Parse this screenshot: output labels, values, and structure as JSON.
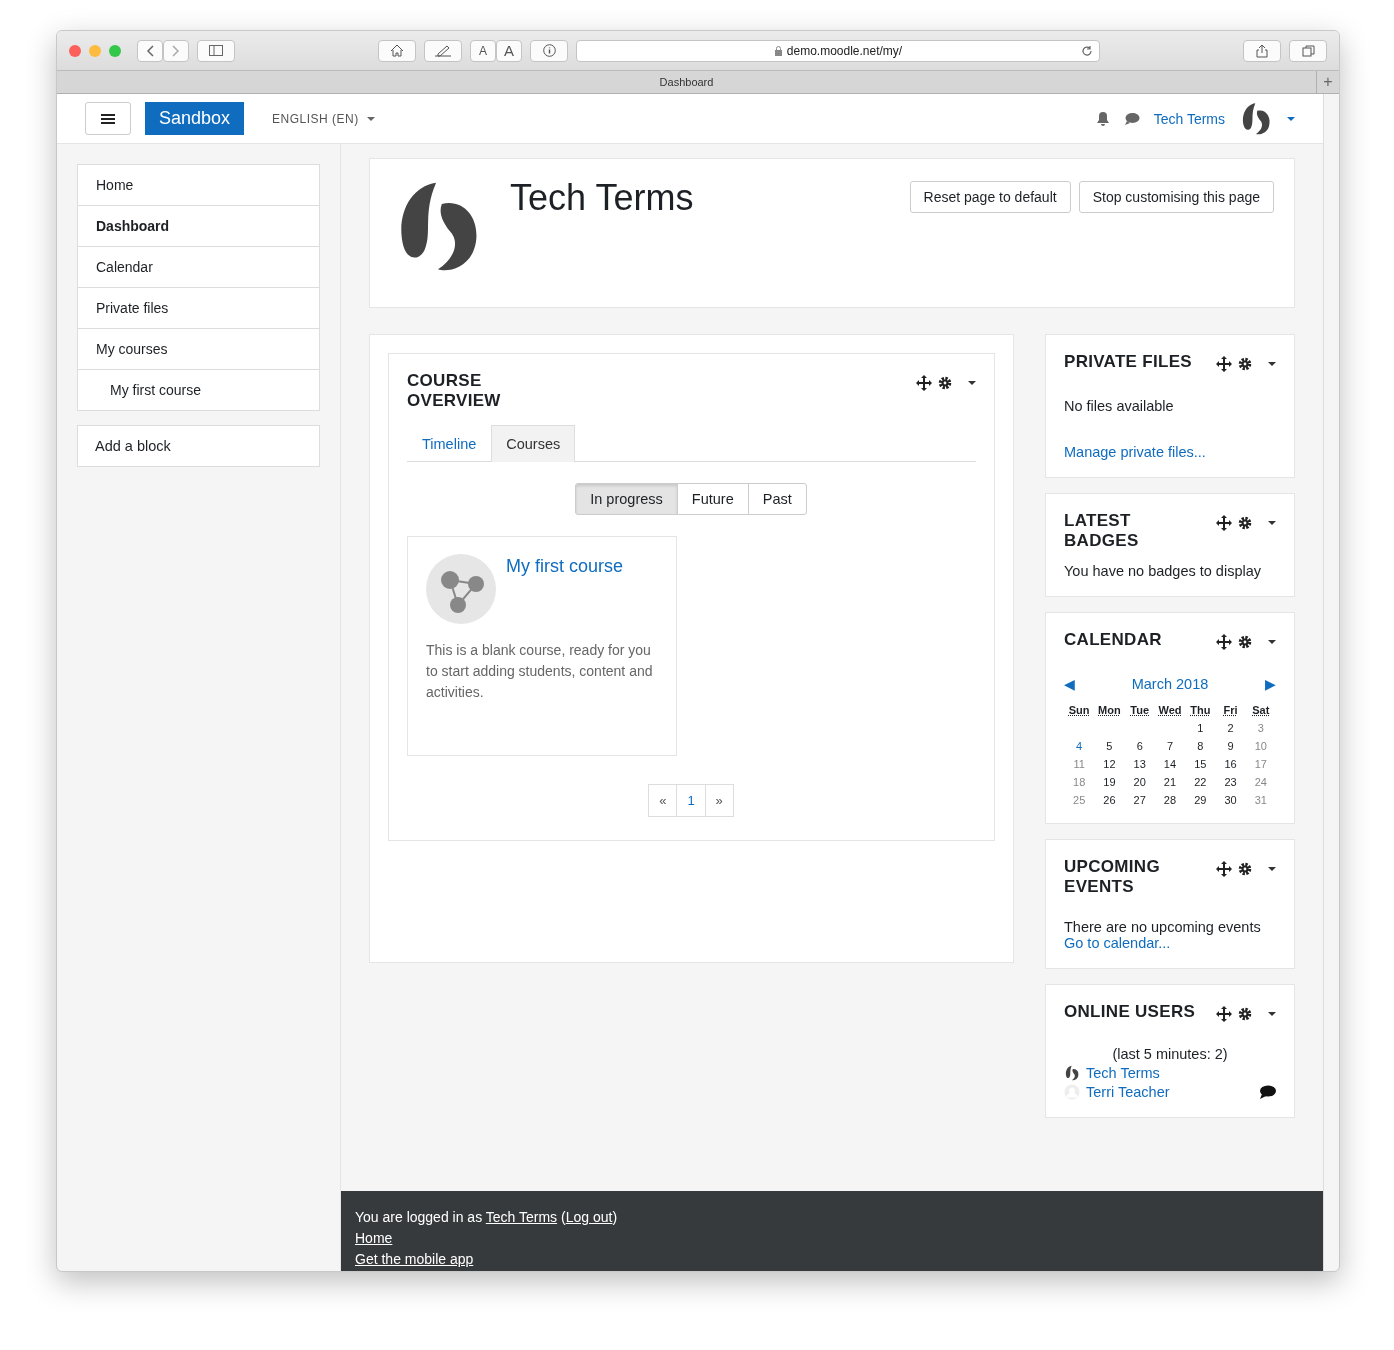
{
  "browser": {
    "url": "demo.moodle.net/my/",
    "font_buttons": [
      "A",
      "A"
    ],
    "tab_title": "Dashboard",
    "new_tab": "+"
  },
  "navbar": {
    "brand": "Sandbox",
    "language": "ENGLISH (EN)",
    "user": "Tech Terms"
  },
  "sidebar": {
    "items": [
      {
        "label": "Home",
        "selected": false
      },
      {
        "label": "Dashboard",
        "selected": true
      },
      {
        "label": "Calendar",
        "selected": false
      },
      {
        "label": "Private files",
        "selected": false
      },
      {
        "label": "My courses",
        "selected": false,
        "children": [
          {
            "label": "My first course",
            "selected": false
          }
        ]
      }
    ],
    "add_block": "Add a block"
  },
  "header": {
    "title": "Tech Terms",
    "buttons": [
      "Reset page to default",
      "Stop customising this page"
    ]
  },
  "course_overview": {
    "title": "COURSE OVERVIEW",
    "tabs": [
      {
        "label": "Timeline",
        "selected": false
      },
      {
        "label": "Courses",
        "selected": true
      }
    ],
    "filters": [
      {
        "label": "In progress",
        "selected": true
      },
      {
        "label": "Future",
        "selected": false
      },
      {
        "label": "Past",
        "selected": false
      }
    ],
    "courses": [
      {
        "name": "My first course",
        "summary": "This is a blank course, ready for you to start adding students, content and activities."
      }
    ],
    "pagination": [
      {
        "label": "«",
        "selected": false
      },
      {
        "label": "1",
        "selected": true
      },
      {
        "label": "»",
        "selected": false
      }
    ]
  },
  "blocks": [
    {
      "kind": "files",
      "title": "PRIVATE FILES",
      "text": "No files available",
      "link": "Manage private files..."
    },
    {
      "kind": "badges",
      "title": "LATEST BADGES",
      "text": "You have no badges to display"
    },
    {
      "kind": "calendar",
      "title": "CALENDAR",
      "month": "March 2018",
      "prev": "◀",
      "next": "▶",
      "weekdays": [
        "Sun",
        "Mon",
        "Tue",
        "Wed",
        "Thu",
        "Fri",
        "Sat"
      ],
      "weeks": [
        [
          {
            "day": "1",
            "kind": "weekday"
          },
          {
            "day": "2",
            "kind": "weekday"
          },
          {
            "day": "3",
            "kind": "weekend"
          }
        ],
        [
          {
            "day": "4",
            "kind": "today"
          },
          {
            "day": "5",
            "kind": "weekday"
          },
          {
            "day": "6",
            "kind": "weekday"
          },
          {
            "day": "7",
            "kind": "weekday"
          },
          {
            "day": "8",
            "kind": "weekday"
          },
          {
            "day": "9",
            "kind": "weekday"
          },
          {
            "day": "10",
            "kind": "weekend"
          }
        ],
        [
          {
            "day": "11",
            "kind": "weekend"
          },
          {
            "day": "12",
            "kind": "weekday"
          },
          {
            "day": "13",
            "kind": "weekday"
          },
          {
            "day": "14",
            "kind": "weekday"
          },
          {
            "day": "15",
            "kind": "weekday"
          },
          {
            "day": "16",
            "kind": "weekday"
          },
          {
            "day": "17",
            "kind": "weekend"
          }
        ],
        [
          {
            "day": "18",
            "kind": "weekend"
          },
          {
            "day": "19",
            "kind": "weekday"
          },
          {
            "day": "20",
            "kind": "weekday"
          },
          {
            "day": "21",
            "kind": "weekday"
          },
          {
            "day": "22",
            "kind": "weekday"
          },
          {
            "day": "23",
            "kind": "weekday"
          },
          {
            "day": "24",
            "kind": "weekend"
          }
        ],
        [
          {
            "day": "25",
            "kind": "weekend"
          },
          {
            "day": "26",
            "kind": "weekday"
          },
          {
            "day": "27",
            "kind": "weekday"
          },
          {
            "day": "28",
            "kind": "weekday"
          },
          {
            "day": "29",
            "kind": "weekday"
          },
          {
            "day": "30",
            "kind": "weekday"
          },
          {
            "day": "31",
            "kind": "weekend"
          }
        ]
      ]
    },
    {
      "kind": "events",
      "title": "UPCOMING EVENTS",
      "text": "There are no upcoming events",
      "link": "Go to calendar..."
    },
    {
      "kind": "users",
      "title": "ONLINE USERS",
      "text": "(last 5 minutes: 2)",
      "users": [
        {
          "name": "Tech Terms",
          "kind": "logo",
          "message": false
        },
        {
          "name": "Terri Teacher",
          "kind": "default",
          "message": true
        }
      ]
    }
  ],
  "footer": {
    "login": [
      {
        "kind": "text",
        "text": "You are logged in as "
      },
      {
        "kind": "link",
        "text": "Tech Terms"
      },
      {
        "kind": "text",
        "text": " ("
      },
      {
        "kind": "link",
        "text": "Log out"
      },
      {
        "kind": "text",
        "text": ")"
      }
    ],
    "links": [
      "Home",
      "Get the mobile app"
    ]
  }
}
